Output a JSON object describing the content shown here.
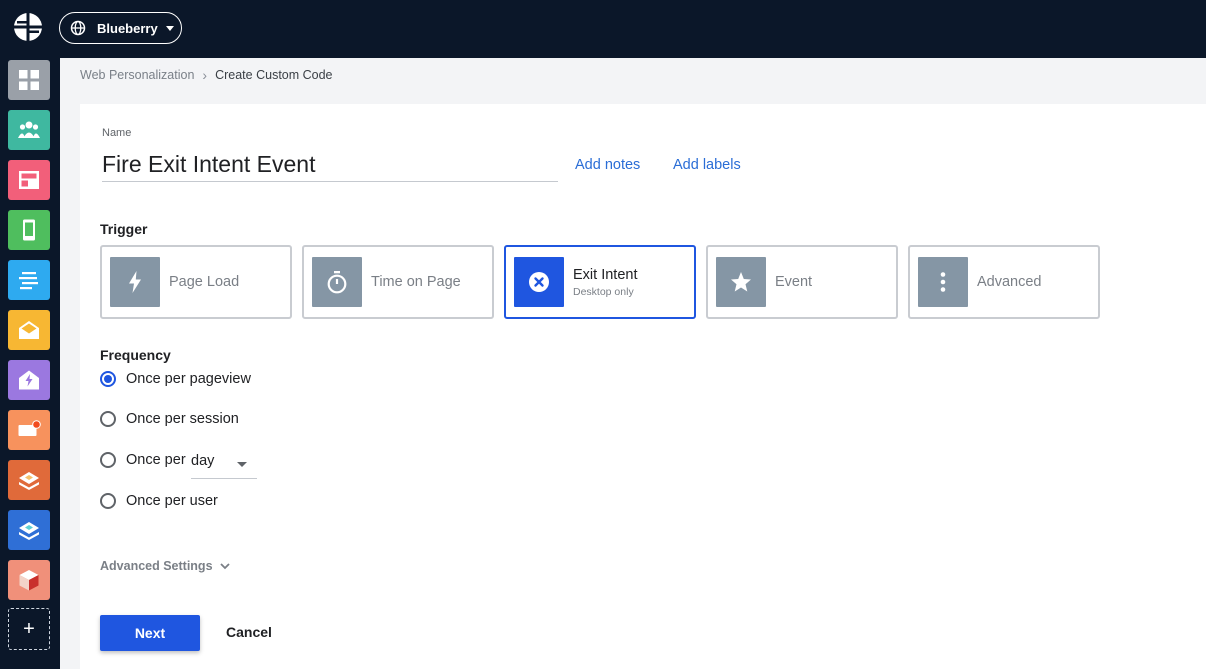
{
  "header": {
    "workspace": "Blueberry"
  },
  "sidebar": {
    "apps": [
      {
        "icon": "dashboard-icon",
        "color": "#9aa0a8"
      },
      {
        "icon": "audience-icon",
        "color": "#3fb8a0"
      },
      {
        "icon": "layout-icon",
        "color": "#f25f7a"
      },
      {
        "icon": "mobile-icon",
        "color": "#4fbe5e"
      },
      {
        "icon": "list-icon",
        "color": "#2eaaf0"
      },
      {
        "icon": "email-icon",
        "color": "#f7b733"
      },
      {
        "icon": "triggered-email-icon",
        "color": "#9b78e0"
      },
      {
        "icon": "notification-icon",
        "color": "#f7925d"
      },
      {
        "icon": "stack-icon",
        "color": "#e06a3a"
      },
      {
        "icon": "layers-icon",
        "color": "#2f6fd6"
      },
      {
        "icon": "cube-icon",
        "color": "#f0907a"
      }
    ],
    "add_label": "+"
  },
  "breadcrumb": {
    "parent": "Web Personalization",
    "current": "Create Custom Code"
  },
  "form": {
    "name_label": "Name",
    "name_value": "Fire Exit Intent Event",
    "add_notes": "Add notes",
    "add_labels": "Add labels",
    "trigger_title": "Trigger",
    "triggers": [
      {
        "label": "Page Load",
        "icon": "lightning-icon",
        "selected": false
      },
      {
        "label": "Time on Page",
        "icon": "stopwatch-icon",
        "selected": false
      },
      {
        "label": "Exit Intent",
        "sub": "Desktop only",
        "icon": "close-circle-icon",
        "selected": true
      },
      {
        "label": "Event",
        "icon": "star-icon",
        "selected": false
      },
      {
        "label": "Advanced",
        "icon": "more-vertical-icon",
        "selected": false
      }
    ],
    "frequency_title": "Frequency",
    "frequency_options": [
      {
        "label": "Once per pageview",
        "checked": true
      },
      {
        "label": "Once per session",
        "checked": false
      },
      {
        "label": "Once per",
        "checked": false
      },
      {
        "label": "Once per user",
        "checked": false
      }
    ],
    "period_value": "day",
    "advanced_settings": "Advanced Settings",
    "next": "Next",
    "cancel": "Cancel",
    "accent_color": "#1f56e0"
  }
}
